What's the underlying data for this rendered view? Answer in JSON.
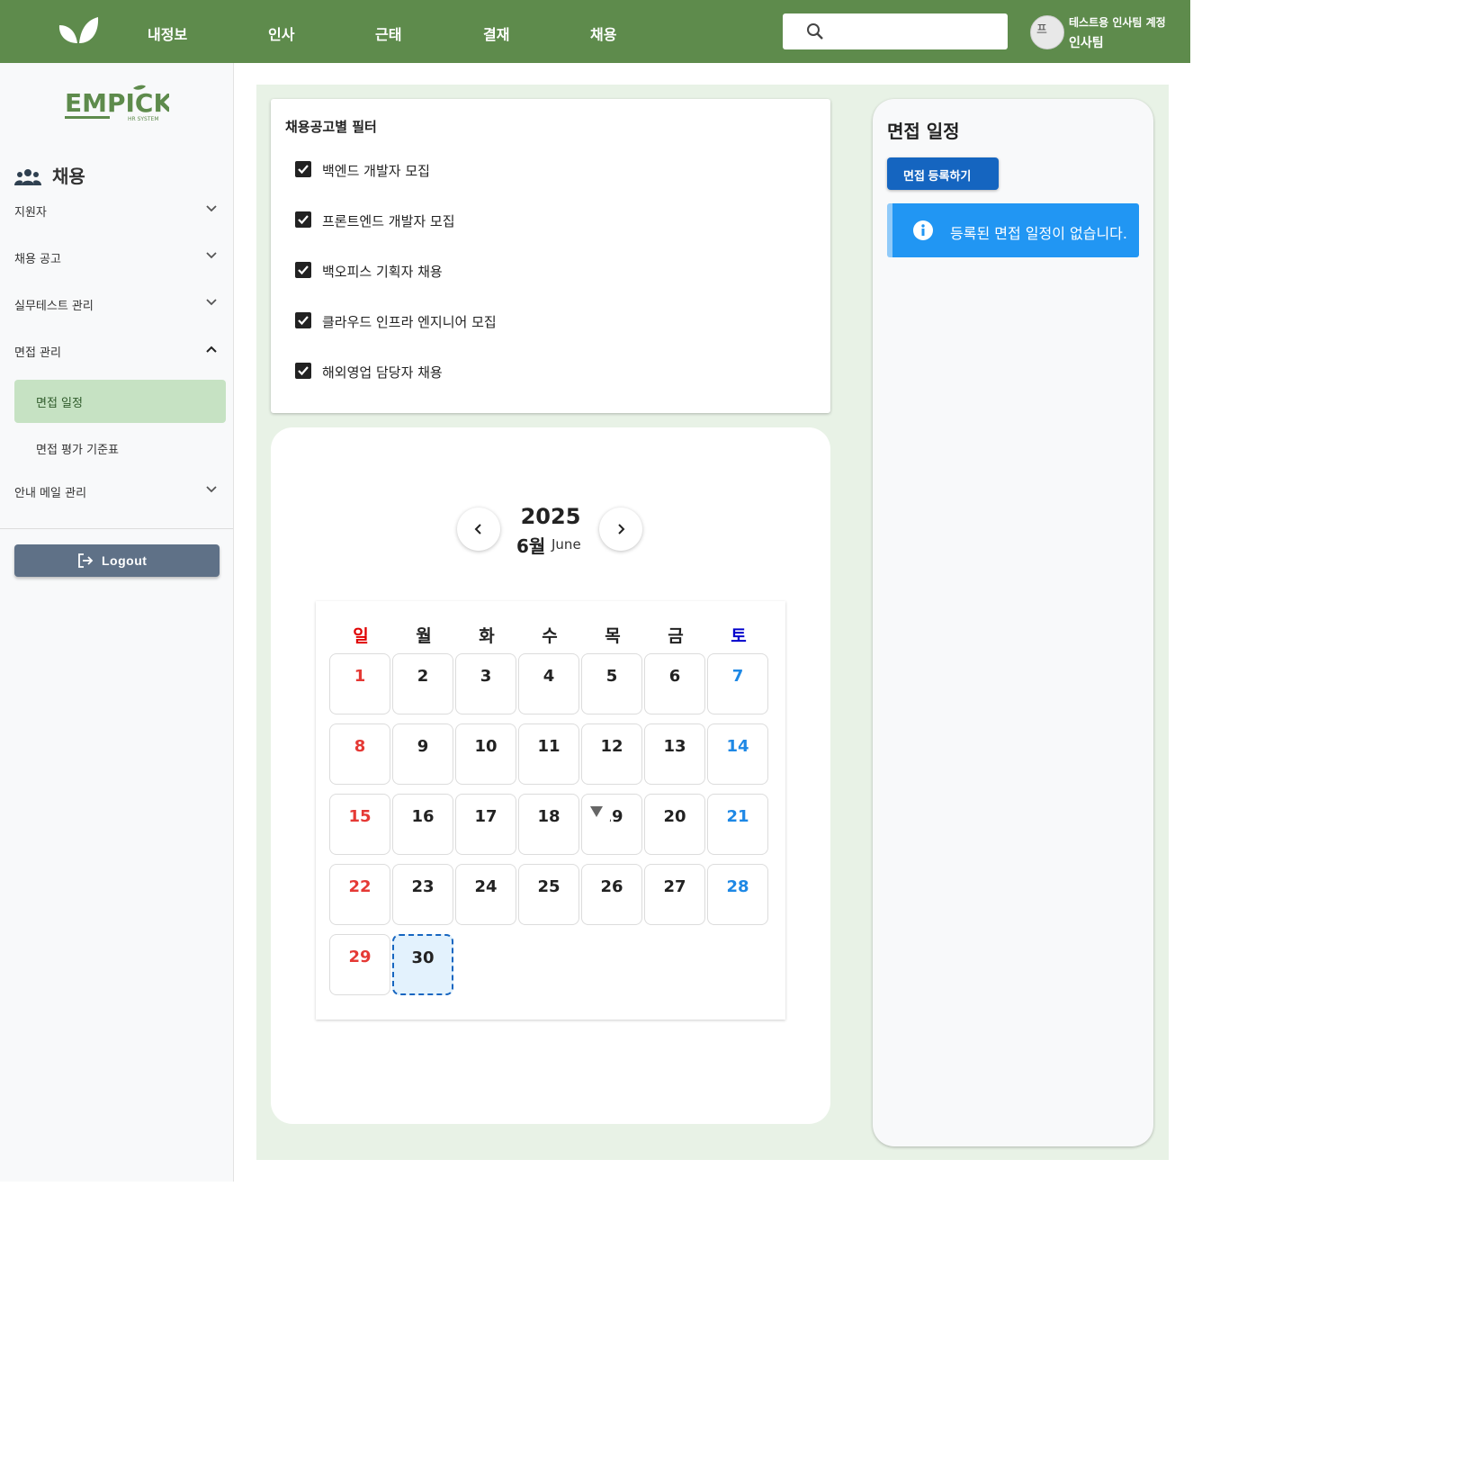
{
  "header": {
    "nav": [
      "내정보",
      "인사",
      "근태",
      "결재",
      "채용"
    ],
    "search": {
      "placeholder": "",
      "value": ""
    },
    "user": {
      "department": "테스트용 인사팀 계정",
      "team": "인사팀",
      "avatar_alt": "프"
    },
    "accent": "#5e8b4c"
  },
  "sidebar": {
    "brand": "EMPICK",
    "brand_sub": "HR SYSTEM",
    "section_title": "채용",
    "menu": [
      {
        "label": "지원자",
        "state": "collapsed"
      },
      {
        "label": "채용 공고",
        "state": "collapsed"
      },
      {
        "label": "실무테스트 관리",
        "state": "collapsed"
      },
      {
        "label": "면접 관리",
        "state": "expanded"
      }
    ],
    "submenu": [
      {
        "label": "면접 일정",
        "active": true
      },
      {
        "label": "면접 평가 기준표",
        "active": false
      }
    ],
    "menu_last": {
      "label": "안내 메일 관리",
      "state": "collapsed"
    },
    "logout": "Logout"
  },
  "filter": {
    "title": "채용공고별 필터",
    "items": [
      {
        "label": "백엔드 개발자 모집",
        "checked": true
      },
      {
        "label": "프론트엔드 개발자 모집",
        "checked": true
      },
      {
        "label": "백오피스 기획자 채용",
        "checked": true
      },
      {
        "label": "클라우드 인프라 엔지니어 모집",
        "checked": true
      },
      {
        "label": "해외영업 담당자 채용",
        "checked": true
      }
    ]
  },
  "calendar": {
    "year": "2025",
    "month_ko": "6월",
    "month_en": "June",
    "weekdays": [
      "일",
      "월",
      "화",
      "수",
      "목",
      "금",
      "토"
    ],
    "first_weekday": 0,
    "days_in_month": 30,
    "today": 30,
    "colors": {
      "sunday": "#e53935",
      "saturday": "#1e88e5",
      "today_border": "#1565c0"
    }
  },
  "schedule_panel": {
    "title": "면접 일정",
    "add_button": "면접 등록하기",
    "empty_message": "등록된 면접 일정이 없습니다."
  }
}
